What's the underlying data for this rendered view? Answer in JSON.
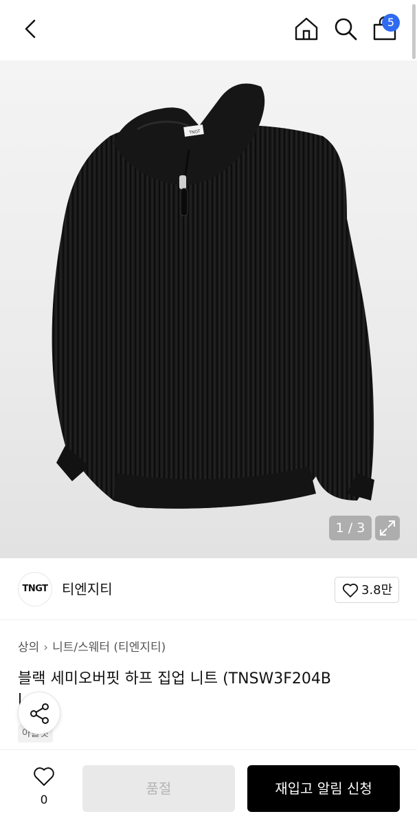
{
  "header": {
    "cart_count": "5",
    "icons": [
      "chevron-left-icon",
      "home-icon",
      "search-icon",
      "shopping-bag-icon"
    ]
  },
  "gallery": {
    "counter": "1 / 3",
    "expand_icon": "expand-icon"
  },
  "brand": {
    "logo_text": "TNGT",
    "name": "티엔지티",
    "like_count": "3.8만"
  },
  "product": {
    "breadcrumb": [
      "상의",
      "니트/스웨터 (티엔지티)"
    ],
    "title": "블랙 세미오버핏 하프 집업 니트 (TNSW3F204B",
    "title_cut_char": "l",
    "tag": "아울렛"
  },
  "bottom_bar": {
    "wish_count": "0",
    "soldout_label": "품절",
    "restock_label": "재입고 알림 신청"
  },
  "colors": {
    "badge": "#2f6bf0",
    "primary_button": "#000000",
    "disabled_button": "#e9e9e9"
  }
}
